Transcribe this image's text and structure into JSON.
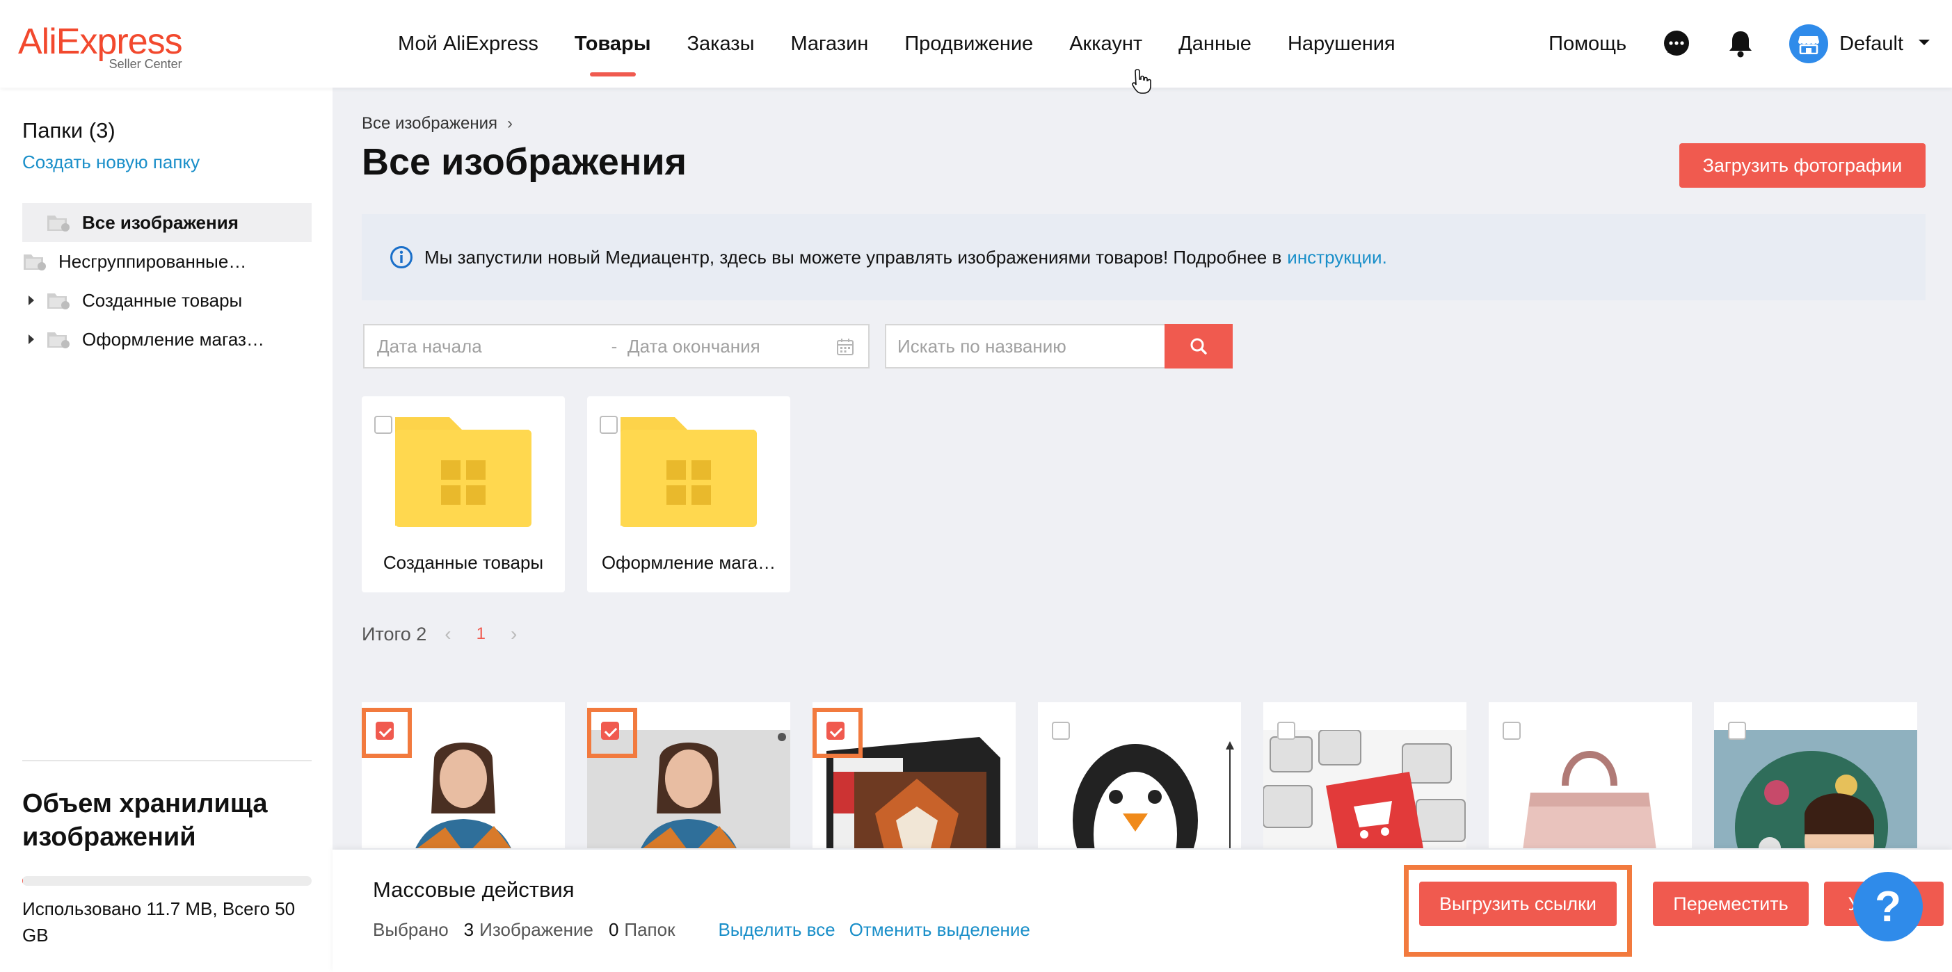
{
  "header": {
    "logo_main": "AliExpress",
    "logo_sub": "Seller Center",
    "nav": [
      "Мой AliExpress",
      "Товары",
      "Заказы",
      "Магазин",
      "Продвижение",
      "Аккаунт",
      "Данные",
      "Нарушения"
    ],
    "active_nav": "Товары",
    "help": "Помощь",
    "account": "Default"
  },
  "sidebar": {
    "folders_title": "Папки (3)",
    "create_folder": "Создать новую папку",
    "tree": [
      "Все изображения",
      "Несгруппированные…",
      "Созданные товары",
      "Оформление магаз…"
    ],
    "storage_title": "Объем хранилища изображений",
    "storage_text": "Использовано 11.7 MB, Всего 50 GB",
    "storage_used_fraction": 0.0002
  },
  "main": {
    "breadcrumb": "Все изображения",
    "title": "Все изображения",
    "upload_button": "Загрузить фотографии",
    "notice_text": "Мы запустили новый Медиацентр, здесь вы можете управлять изображениями товаров! Подробнее в",
    "notice_link": "инструкции.",
    "date_start_placeholder": "Дата начала",
    "date_separator": "-",
    "date_end_placeholder": "Дата окончания",
    "search_placeholder": "Искать по названию",
    "folders": [
      "Созданные товары",
      "Оформление мага…"
    ],
    "pager_total": "Итого 2",
    "pager_page": "1",
    "images": [
      {
        "name": "woman-scarf",
        "checked": true
      },
      {
        "name": "woman-scarf-2",
        "checked": true
      },
      {
        "name": "fox-puzzle-box",
        "checked": true
      },
      {
        "name": "penguin-toy",
        "checked": false
      },
      {
        "name": "keyboard-shop",
        "checked": false
      },
      {
        "name": "pink-bag",
        "checked": false
      },
      {
        "name": "doll",
        "checked": false
      }
    ]
  },
  "bulk": {
    "title": "Массовые действия",
    "selected_label": "Выбрано",
    "images_count": "3",
    "images_label": "Изображение",
    "folders_count": "0",
    "folders_label": "Папок",
    "select_all": "Выделить все",
    "deselect": "Отменить выделение",
    "export_links": "Выгрузить ссылки",
    "move": "Переместить",
    "delete": "Удалить"
  },
  "help_fab": "?",
  "colors": {
    "accent": "#f05a4f",
    "link": "#1a8fc9",
    "highlight": "#f27a3e",
    "brand_blue": "#2f8bea"
  }
}
